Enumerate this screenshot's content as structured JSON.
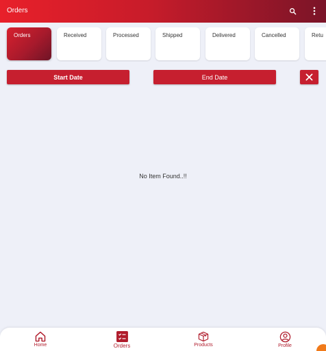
{
  "appbar": {
    "title": "Orders",
    "search_icon": "search-icon",
    "more_icon": "more-vert-icon"
  },
  "tabs": [
    {
      "label": "Orders",
      "active": true
    },
    {
      "label": "Received",
      "active": false
    },
    {
      "label": "Processed",
      "active": false
    },
    {
      "label": "Shipped",
      "active": false
    },
    {
      "label": "Delivered",
      "active": false
    },
    {
      "label": "Cancelled",
      "active": false
    },
    {
      "label": "Retu",
      "active": false
    }
  ],
  "filters": {
    "start_date_label": "Start Date",
    "end_date_label": "End Date",
    "clear_icon": "close-icon"
  },
  "empty_message": "No Item Found..!!",
  "bottom_nav": [
    {
      "label": "Home",
      "icon": "home-icon"
    },
    {
      "label": "Orders",
      "icon": "orders-icon",
      "active": true
    },
    {
      "label": "Products",
      "icon": "box-icon"
    },
    {
      "label": "Profile",
      "icon": "profile-icon"
    }
  ],
  "colors": {
    "primary": "#c61f2f",
    "appbar_start": "#e8202a",
    "appbar_end": "#7a1428",
    "background": "#eef0f8",
    "accent_orange": "#f07a1a"
  }
}
